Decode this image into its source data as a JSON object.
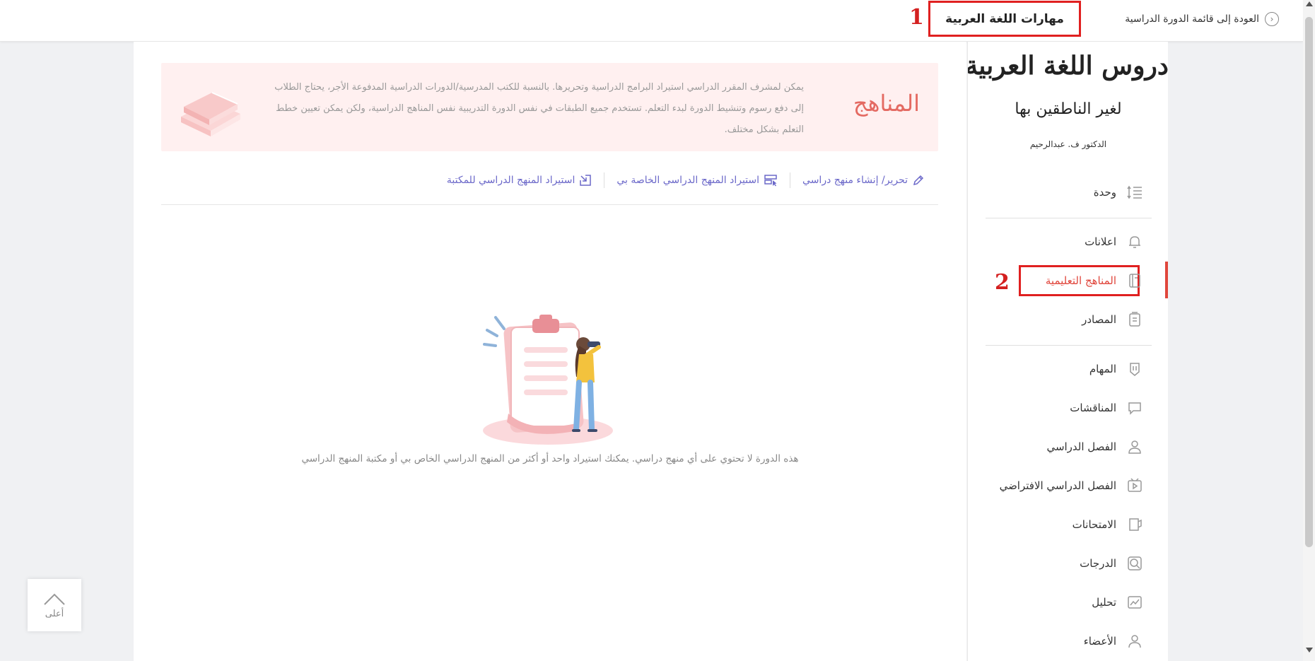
{
  "topbar": {
    "back_label": "العودة إلى قائمة الدورة الدراسية",
    "course_title": "مهارات اللغة العربية"
  },
  "annotations": {
    "marker1": "1",
    "marker2": "2"
  },
  "banner": {
    "title": "المناهج",
    "description": "يمكن لمشرف المقرر الدراسي استيراد البرامج الدراسية وتحريرها. بالنسبة للكتب المدرسية/الدورات الدراسية المدفوعة الأجر، يحتاج الطلاب إلى دفع رسوم وتنشيط الدورة لبدء التعلم. تستخدم جميع الطبقات في نفس الدورة التدريبية نفس المناهج الدراسية، ولكن يمكن تعيين خطط التعلم بشكل مختلف."
  },
  "actions": {
    "edit": "تحرير/ إنشاء منهج دراسي",
    "import_mine": "استيراد المنهج الدراسي الخاصة بي",
    "import_library": "استيراد المنهج الدراسي للمكتبة"
  },
  "empty_state": {
    "message": "هذه الدورة لا تحتوي على أي منهج دراسي. يمكنك استيراد واحد أو أكثر من المنهج الدراسي الخاص بي أو مكتبة المنهج الدراسي"
  },
  "back_to_top": {
    "label": "أعلى"
  },
  "book_logo": {
    "title": "دروس اللغة العربية",
    "subtitle": "لغير الناطقين بها",
    "author": "الدكتور ف. عبدالرحيم"
  },
  "sidebar": {
    "items": [
      {
        "label": "وحدة",
        "icon": "list-icon"
      },
      {
        "label": "اعلانات",
        "icon": "bell-icon"
      },
      {
        "label": "المناهج التعليمية",
        "icon": "book-icon",
        "active": true
      },
      {
        "label": "المصادر",
        "icon": "resources-icon"
      },
      {
        "label": "المهام",
        "icon": "task-icon"
      },
      {
        "label": "المناقشات",
        "icon": "chat-icon"
      },
      {
        "label": "الفصل الدراسي",
        "icon": "person-icon"
      },
      {
        "label": "الفصل الدراسي الافتراضي",
        "icon": "video-icon"
      },
      {
        "label": "الامتحانات",
        "icon": "exam-icon"
      },
      {
        "label": "الدرجات",
        "icon": "grade-icon"
      },
      {
        "label": "تحليل",
        "icon": "chart-icon"
      },
      {
        "label": "الأعضاء",
        "icon": "members-icon"
      }
    ]
  },
  "colors": {
    "accent_red": "#e0463c",
    "action_purple": "#6b68c9",
    "banner_bg": "#fff0f0"
  }
}
